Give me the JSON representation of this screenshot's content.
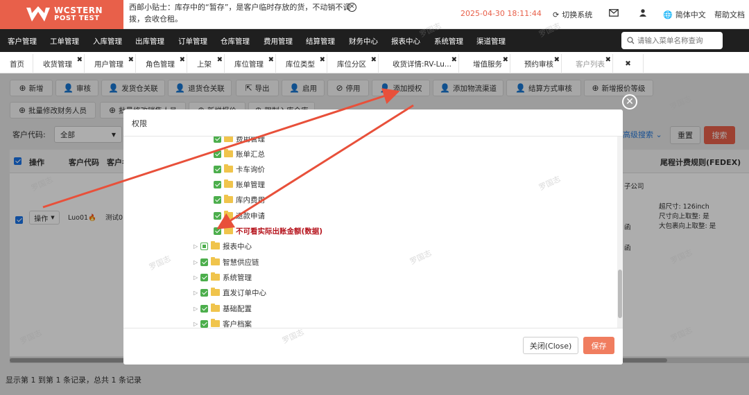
{
  "header": {
    "logo_line1": "WCSTERN",
    "logo_line2": "POST TEST",
    "tip": "西邮小贴士：库存中的“暂存”，是客户临时存放的货，不动销不调拨，会收仓租。",
    "datetime": "2025-04-30 18:11:44",
    "switch_system": "切换系统",
    "language": "简体中文",
    "help": "帮助文档"
  },
  "nav": {
    "items": [
      "客户管理",
      "工单管理",
      "入库管理",
      "出库管理",
      "订单管理",
      "仓库管理",
      "费用管理",
      "结算管理",
      "财务中心",
      "报表中心",
      "系统管理",
      "渠道管理"
    ],
    "search_placeholder": "请输入菜单名称查询"
  },
  "tabs": [
    "首页",
    "收货管理",
    "用户管理",
    "角色管理",
    "上架",
    "库位管理",
    "库位类型",
    "库位分区",
    "收货详情:RV-Lu...",
    "增值服务",
    "预约审核",
    "客户列表"
  ],
  "toolbar": {
    "row1": [
      "新增",
      "审核",
      "发货仓关联",
      "退货仓关联",
      "导出",
      "启用",
      "停用",
      "添加授权",
      "添加物流渠道",
      "结算方式审核",
      "新增报价等级"
    ],
    "row2": [
      "批量修改财务人员",
      "批量修改销售人员",
      "新增报价",
      "限制入库仓库"
    ]
  },
  "filter": {
    "customer_code_label": "客户代码:",
    "customer_code_value": "全部",
    "advanced": "高级搜索",
    "reset": "重置",
    "search": "搜索"
  },
  "table": {
    "headers": [
      "操作",
      "客户代码",
      "客户名",
      "尾程计费规则(FEDEX)"
    ],
    "row": {
      "op": "操作",
      "code": "Luo01",
      "name": "测试0",
      "company": "子公司",
      "zhi1": "函",
      "zhi2": "函",
      "rules": [
        "超尺寸: 126inch",
        "尺寸向上取整: 是",
        "大包裹向上取整: 是"
      ]
    },
    "footer": "显示第 1 到第 1 条记录，总共 1 条记录"
  },
  "modal": {
    "title": "权限",
    "nodes": [
      {
        "label": "费用管理",
        "level": 2,
        "state": "full"
      },
      {
        "label": "账单汇总",
        "level": 2,
        "state": "full"
      },
      {
        "label": "卡车询价",
        "level": 2,
        "state": "full"
      },
      {
        "label": "账单管理",
        "level": 2,
        "state": "full"
      },
      {
        "label": "库内费用",
        "level": 2,
        "state": "full"
      },
      {
        "label": "退款申请",
        "level": 2,
        "state": "full"
      },
      {
        "label": "不可看实际出账金额(数据)",
        "level": 2,
        "state": "full",
        "highlight": true
      },
      {
        "label": "报表中心",
        "level": 1,
        "state": "part"
      },
      {
        "label": "智慧供应链",
        "level": 1,
        "state": "full"
      },
      {
        "label": "系统管理",
        "level": 1,
        "state": "full"
      },
      {
        "label": "直发订单中心",
        "level": 1,
        "state": "full"
      },
      {
        "label": "基础配置",
        "level": 1,
        "state": "full"
      },
      {
        "label": "客户档案",
        "level": 1,
        "state": "full"
      }
    ],
    "close_label": "关闭(Close)",
    "save_label": "保存"
  },
  "watermark": "罗国志",
  "colors": {
    "brand": "#e8604a",
    "nav_bg": "#1f1f1f",
    "arrow": "#e8503a",
    "check_green": "#4cae4c",
    "highlight_red": "#b5121b"
  }
}
